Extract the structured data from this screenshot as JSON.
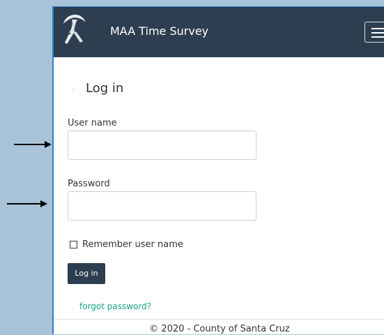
{
  "navbar": {
    "brand": "MAA Time Survey"
  },
  "login": {
    "title": "Log in",
    "username_label": "User name",
    "password_label": "Password",
    "remember_label": "Remember user name",
    "submit_label": "Log in",
    "forgot_label": "forgot password?"
  },
  "footer": {
    "text": "© 2020 - County of Santa Cruz"
  },
  "icons": {
    "logo": "county-logo-icon",
    "menu": "hamburger-menu-icon",
    "annotation_arrows": "arrow-right-icon"
  },
  "colors": {
    "navbar_bg": "#2d3e50",
    "link": "#18a18a",
    "outer_bg": "#a8c3d8"
  }
}
